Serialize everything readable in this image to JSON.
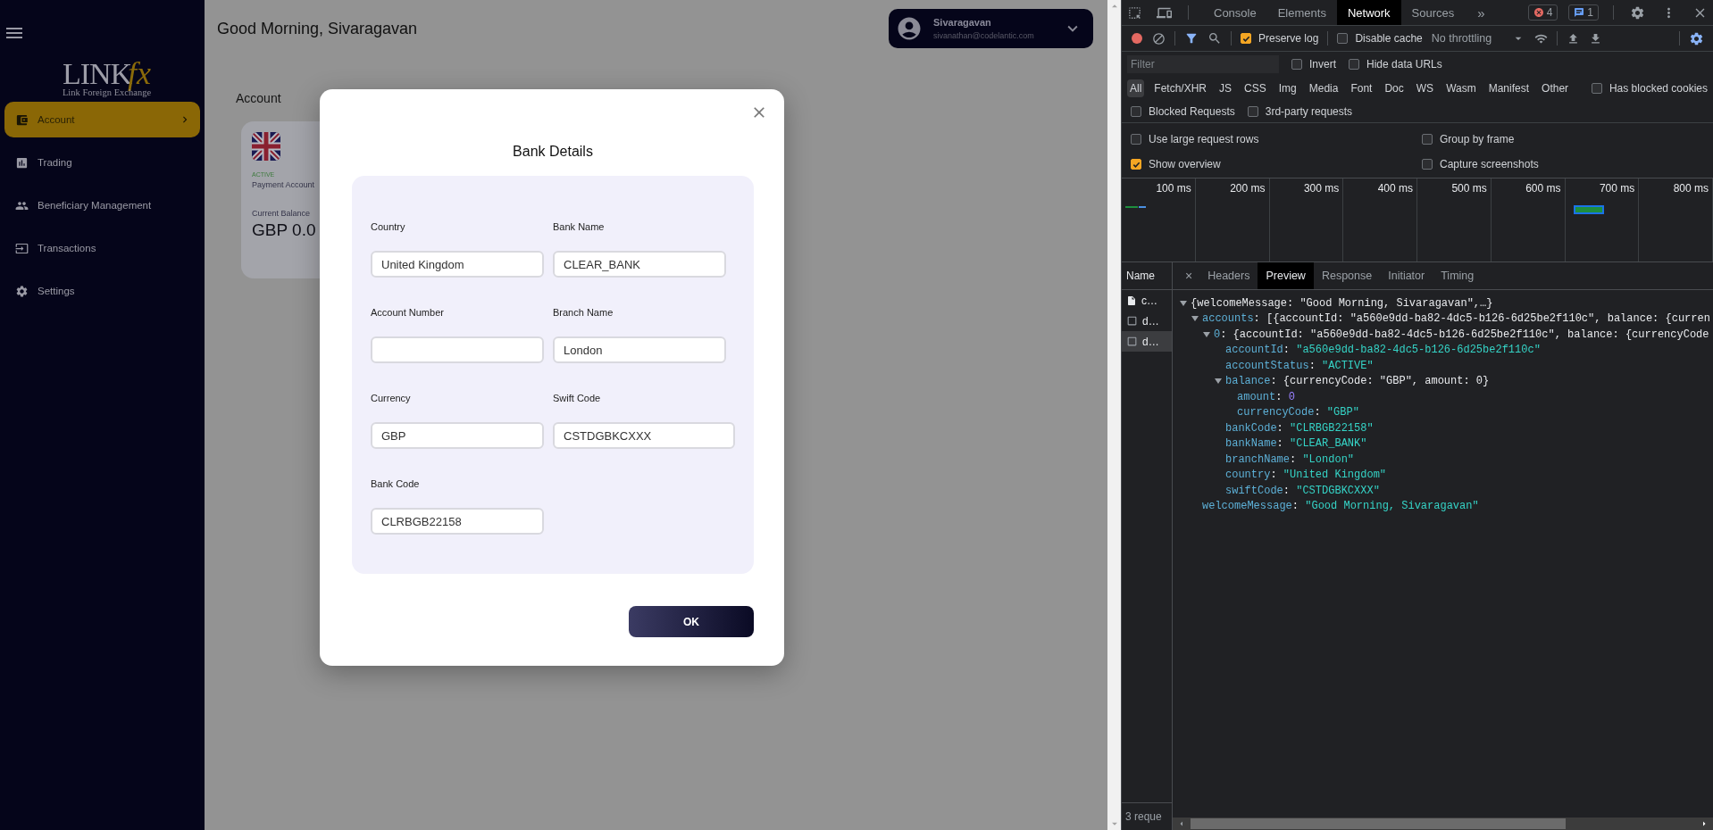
{
  "sidebar": {
    "logo": {
      "wordmark": "LINK",
      "accent": "fx",
      "tagline": "Link Foreign Exchange"
    },
    "items": [
      {
        "label": "Account",
        "selected": true
      },
      {
        "label": "Trading",
        "selected": false
      },
      {
        "label": "Beneficiary Management",
        "selected": false
      },
      {
        "label": "Transactions",
        "selected": false
      },
      {
        "label": "Settings",
        "selected": false
      }
    ]
  },
  "header": {
    "greeting": "Good Morning, Sivaragavan",
    "user": {
      "name": "Sivaragavan",
      "email": "sivanathan@codelantic.com"
    }
  },
  "page": {
    "title": "Account",
    "card": {
      "status": "ACTIVE",
      "type": "Payment Account",
      "balance_label": "Current Balance",
      "balance": "GBP 0.0"
    }
  },
  "modal": {
    "title": "Bank Details",
    "fields": [
      {
        "label": "Country",
        "value": "United Kingdom"
      },
      {
        "label": "Bank Name",
        "value": "CLEAR_BANK"
      },
      {
        "label": "Account Number"
      },
      {
        "label": "Branch Name",
        "value": "London"
      },
      {
        "label": "Currency",
        "value": "GBP"
      },
      {
        "label": "Swift Code",
        "value": "CSTDGBKCXXX"
      },
      {
        "label": "Bank Code",
        "value": "CLRBGB22158"
      }
    ],
    "button": "OK"
  },
  "devtools": {
    "tabs": [
      {
        "label": "Console",
        "selected": false
      },
      {
        "label": "Elements",
        "selected": false
      },
      {
        "label": "Network",
        "selected": true
      },
      {
        "label": "Sources",
        "selected": false
      }
    ],
    "more": "»",
    "errors": "4",
    "messages": "1",
    "preserve_log": {
      "label": "Preserve log",
      "checked": true
    },
    "disable_cache": {
      "label": "Disable cache",
      "checked": false
    },
    "throttling": "No throttling",
    "filter": {
      "placeholder": "Filter"
    },
    "filter_options": [
      {
        "label": "Invert",
        "checked": false
      },
      {
        "label": "Hide data URLs",
        "checked": false
      }
    ],
    "types": [
      {
        "label": "All",
        "selected": true
      },
      {
        "label": "Fetch/XHR",
        "selected": false
      },
      {
        "label": "JS",
        "selected": false
      },
      {
        "label": "CSS",
        "selected": false
      },
      {
        "label": "Img",
        "selected": false
      },
      {
        "label": "Media",
        "selected": false
      },
      {
        "label": "Font",
        "selected": false
      },
      {
        "label": "Doc",
        "selected": false
      },
      {
        "label": "WS",
        "selected": false
      },
      {
        "label": "Wasm",
        "selected": false
      },
      {
        "label": "Manifest",
        "selected": false
      },
      {
        "label": "Other",
        "selected": false
      }
    ],
    "blocked_cookies": {
      "label": "Has blocked cookies",
      "checked": false
    },
    "request_options": [
      {
        "label": "Blocked Requests",
        "checked": false
      },
      {
        "label": "3rd-party requests",
        "checked": false
      }
    ],
    "settings": [
      {
        "label": "Use large request rows",
        "checked": false
      },
      {
        "label": "Group by frame",
        "checked": false
      },
      {
        "label": "Show overview",
        "checked": true
      },
      {
        "label": "Capture screenshots",
        "checked": false
      }
    ],
    "overview_ticks": [
      "100 ms",
      "200 ms",
      "300 ms",
      "400 ms",
      "500 ms",
      "600 ms",
      "700 ms",
      "800 ms"
    ],
    "name_header": "Name",
    "requests": [
      {
        "name": "c…",
        "selected": false
      },
      {
        "name": "d…",
        "selected": false
      },
      {
        "name": "d…",
        "selected": true
      }
    ],
    "status": "3 reque",
    "detail_close": "×",
    "key_separator": ":",
    "detail_tabs": [
      {
        "label": "Headers",
        "selected": false
      },
      {
        "label": "Preview",
        "selected": true
      },
      {
        "label": "Response",
        "selected": false
      },
      {
        "label": "Initiator",
        "selected": false
      },
      {
        "label": "Timing",
        "selected": false
      }
    ],
    "preview": [
      {
        "summary": "{welcomeMessage: \"Good Morning, Sivaragavan\",…}",
        "expanded": true,
        "children": [
          {
            "key": "accounts",
            "summary": "[{accountId: \"a560e9dd-ba82-4dc5-b126-6d25be2f110c\", balance: {curren",
            "expanded": true,
            "children": [
              {
                "key": "0",
                "summary": "{accountId: \"a560e9dd-ba82-4dc5-b126-6d25be2f110c\", balance: {currencyCode",
                "expanded": true,
                "children": [
                  {
                    "key": "accountId",
                    "value": "\"a560e9dd-ba82-4dc5-b126-6d25be2f110c\"",
                    "kind": "string"
                  },
                  {
                    "key": "accountStatus",
                    "value": "\"ACTIVE\"",
                    "kind": "string"
                  },
                  {
                    "key": "balance",
                    "summary": "{currencyCode: \"GBP\", amount: 0}",
                    "expanded": true,
                    "children": [
                      {
                        "key": "amount",
                        "value": "0",
                        "kind": "number"
                      },
                      {
                        "key": "currencyCode",
                        "value": "\"GBP\"",
                        "kind": "string"
                      }
                    ]
                  },
                  {
                    "key": "bankCode",
                    "value": "\"CLRBGB22158\"",
                    "kind": "string"
                  },
                  {
                    "key": "bankName",
                    "value": "\"CLEAR_BANK\"",
                    "kind": "string"
                  },
                  {
                    "key": "branchName",
                    "value": "\"London\"",
                    "kind": "string"
                  },
                  {
                    "key": "country",
                    "value": "\"United Kingdom\"",
                    "kind": "string"
                  },
                  {
                    "key": "swiftCode",
                    "value": "\"CSTDGBKCXXX\"",
                    "kind": "string"
                  }
                ]
              }
            ]
          },
          {
            "key": "welcomeMessage",
            "value": "\"Good Morning, Sivaragavan\"",
            "kind": "string"
          }
        ]
      }
    ]
  }
}
